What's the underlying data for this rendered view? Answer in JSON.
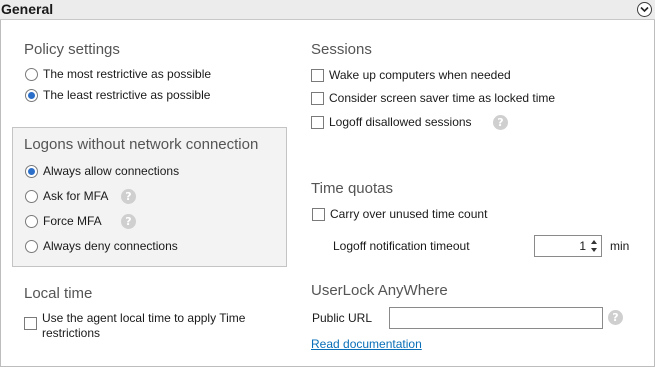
{
  "header": {
    "title": "General"
  },
  "policy": {
    "title": "Policy settings",
    "options": [
      {
        "label": "The most restrictive as possible",
        "selected": false
      },
      {
        "label": "The least restrictive as possible",
        "selected": true
      }
    ]
  },
  "logons": {
    "title": "Logons without network connection",
    "options": [
      {
        "label": "Always allow connections",
        "selected": true
      },
      {
        "label": "Ask for MFA",
        "selected": false,
        "help": true
      },
      {
        "label": "Force MFA",
        "selected": false,
        "help": true
      },
      {
        "label": "Always deny connections",
        "selected": false
      }
    ]
  },
  "local_time": {
    "title": "Local time",
    "checkbox_label": "Use the agent local time to apply Time restrictions",
    "checked": false
  },
  "sessions": {
    "title": "Sessions",
    "options": [
      {
        "label": "Wake up computers when needed",
        "checked": false
      },
      {
        "label": "Consider screen saver time as locked time",
        "checked": false
      },
      {
        "label": "Logoff disallowed sessions",
        "checked": false,
        "help": true
      }
    ]
  },
  "time_quotas": {
    "title": "Time quotas",
    "carry_over_label": "Carry over unused time count",
    "carry_over_checked": false,
    "logoff_timeout_label": "Logoff notification timeout",
    "logoff_timeout_value": "1",
    "logoff_timeout_unit": "min"
  },
  "userlock_anywhere": {
    "title": "UserLock AnyWhere",
    "public_url_label": "Public URL",
    "public_url_value": "",
    "read_doc_link": "Read documentation"
  },
  "help_glyph": "?",
  "colors": {
    "accent": "#2b6fc9",
    "link": "#0a6fb8",
    "section_title": "#555555",
    "group_bg": "#f3f3f3"
  }
}
